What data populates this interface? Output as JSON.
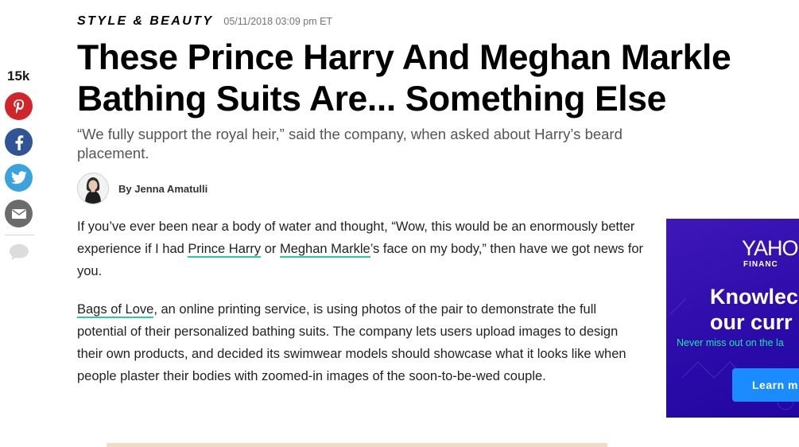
{
  "share": {
    "count": "15k",
    "buttons": [
      {
        "network": "pinterest",
        "icon": "pinterest-icon",
        "color": "#d0262b"
      },
      {
        "network": "facebook",
        "icon": "facebook-icon",
        "color": "#2f5597"
      },
      {
        "network": "twitter",
        "icon": "twitter-icon",
        "color": "#3aa2dd"
      },
      {
        "network": "email",
        "icon": "email-icon",
        "color": "#6b6b6b"
      }
    ],
    "comment_icon": "comment-icon"
  },
  "article": {
    "section": "STYLE & BEAUTY",
    "timestamp": "05/11/2018 03:09 pm ET",
    "headline": "These Prince Harry And Meghan Markle Bathing Suits Are... Something Else",
    "dek": "“We fully support the royal heir,” said the company, when asked about Harry’s beard placement.",
    "byline": "By Jenna Amatulli",
    "paragraph1": {
      "before": "If you’ve ever been near a body of water and thought, “Wow, this would be an enormously better experience if I had ",
      "link1": "Prince Harry",
      "between": " or ",
      "link2": "Meghan Markle",
      "after": "’s face on my body,” then have we got news for you."
    },
    "paragraph2": {
      "link": "Bags of Love",
      "after": ", an online printing service, is using photos of the pair to demonstrate the full potential of their personalized bathing suits. The company lets users upload images to design their own products, and decided its swimwear models should showcase what it looks like when people plaster their bodies with zoomed-in images of the soon-to-be-wed couple."
    },
    "link_underline_color": "#2bc8a4"
  },
  "ad": {
    "logo": "YAHO",
    "logo_sub": "FINANC",
    "headline_line1": "Knowlec",
    "headline_line2": "our curr",
    "subline": "Never miss out on the la",
    "button": "Learn m",
    "colors": {
      "background": "#2a0ba8",
      "accent": "#19e6a8",
      "button": "#1a8cff"
    }
  }
}
